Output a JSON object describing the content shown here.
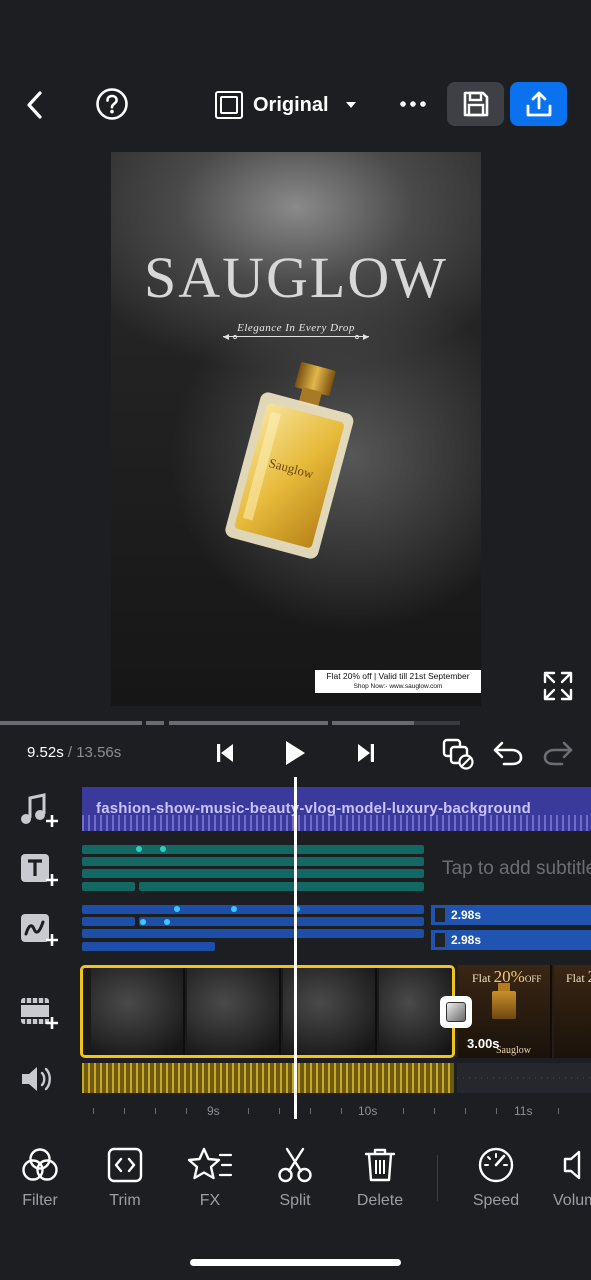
{
  "header": {
    "back_icon": "chevron-left-icon",
    "help_icon": "question-circle-icon",
    "aspect_label": "Original",
    "more_icon": "ellipsis-icon",
    "save_icon": "floppy-disk-icon",
    "export_icon": "share-upload-icon",
    "export_color": "#0a72ee"
  },
  "preview": {
    "brand": "SAUGLOW",
    "tagline": "Elegance In Every Drop",
    "bottle_label": "Sauglow",
    "offer_line1": "Flat 20% off | Valid till 21st September",
    "offer_line2": "Shop Now:- www.sauglow.com"
  },
  "playback": {
    "current_time": "9.52s",
    "separator": " / ",
    "total_time": "13.56s"
  },
  "timeline": {
    "music_clip": "fashion-show-music-beauty-vlog-model-luxury-background",
    "subtitle_hint": "Tap to add subtitles",
    "sticker_clips": [
      "2.98s",
      "2.98s"
    ],
    "next_clip_duration": "3.00s",
    "next_clip_text": "Flat",
    "next_clip_percent": "20%",
    "next_clip_off": "OFF",
    "next_clip_brand": "Sauglow",
    "ruler": [
      "9s",
      "10s",
      "11s"
    ],
    "accent_color": "#f0c419"
  },
  "toolbar": [
    {
      "label": "Filter",
      "icon": "filter-circles-icon"
    },
    {
      "label": "Trim",
      "icon": "trim-icon"
    },
    {
      "label": "FX",
      "icon": "fx-star-icon"
    },
    {
      "label": "Split",
      "icon": "scissors-icon"
    },
    {
      "label": "Delete",
      "icon": "trash-icon"
    },
    {
      "label": "Speed",
      "icon": "speedometer-icon"
    },
    {
      "label": "Volume",
      "icon": "speaker-icon"
    }
  ]
}
